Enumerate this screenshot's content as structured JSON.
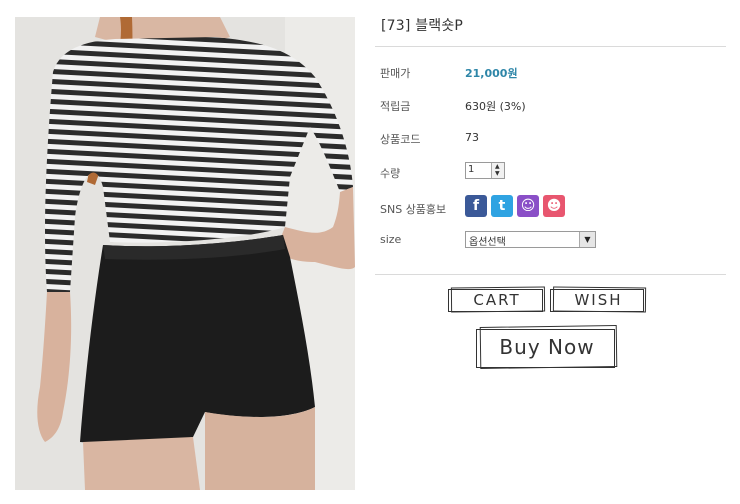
{
  "product": {
    "title": "[73] 블랙숏P"
  },
  "fields": {
    "price_label": "판매가",
    "price_value": "21,000원",
    "points_label": "적립금",
    "points_value": "630원 (3%)",
    "code_label": "상품코드",
    "code_value": "73",
    "quantity_label": "수량",
    "quantity_value": "1",
    "sns_label": "SNS 상품홍보",
    "size_label": "size",
    "size_selected": "옵션선택"
  },
  "sns_icons": [
    {
      "name": "facebook-icon",
      "glyph": "f",
      "color": "#3b5998"
    },
    {
      "name": "twitter-icon",
      "glyph": "t",
      "color": "#2fa3e2"
    },
    {
      "name": "me2day-icon",
      "glyph": "☺",
      "color": "#8a4fc7"
    },
    {
      "name": "yozm-icon",
      "glyph": "☻",
      "color": "#e8566f"
    }
  ],
  "buttons": {
    "cart": "CART",
    "wish": "WISH",
    "buy": "Buy Now"
  },
  "colors": {
    "price": "#2e86a8",
    "divider": "#dadada"
  }
}
